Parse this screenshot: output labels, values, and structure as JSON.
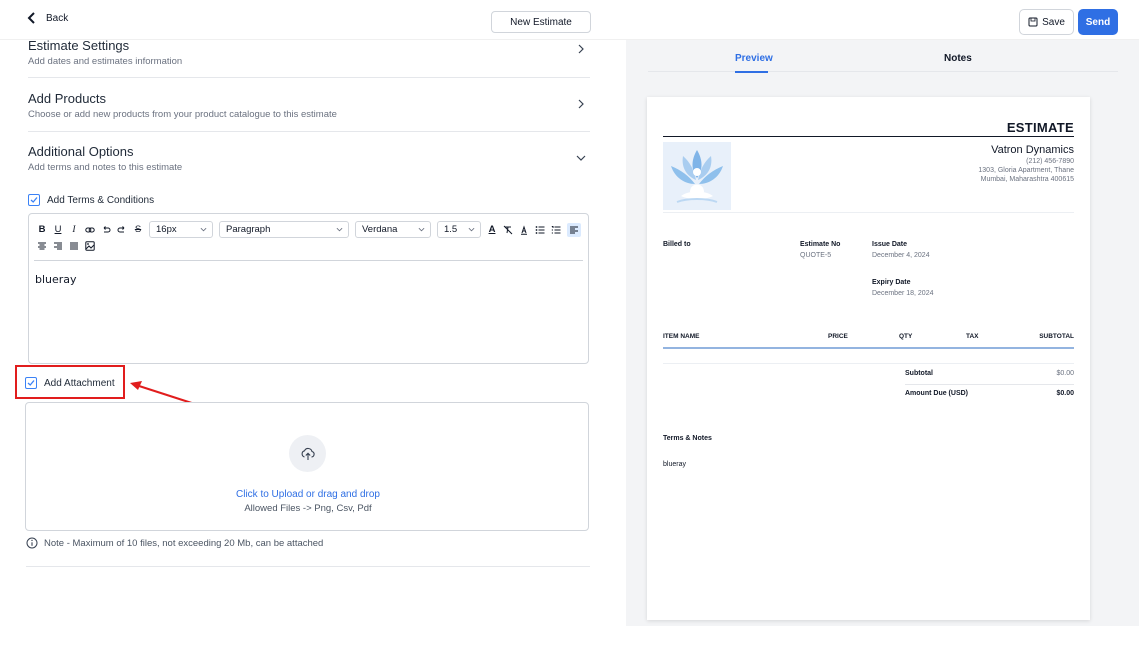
{
  "header": {
    "back_label": "Back",
    "document_title": "New Estimate",
    "save_label": "Save",
    "send_label": "Send"
  },
  "sections": [
    {
      "title": "Estimate Settings",
      "subtitle": "Add dates and estimates information",
      "expanded": false
    },
    {
      "title": "Add Products",
      "subtitle": "Choose or add new products from your product catalogue to this estimate",
      "expanded": false
    },
    {
      "title": "Additional Options",
      "subtitle": "Add terms and notes to this estimate",
      "expanded": true
    }
  ],
  "terms": {
    "checkbox_label": "Add Terms & Conditions",
    "checked": true,
    "font_size": "16px",
    "block_type": "Paragraph",
    "font_family": "Verdana",
    "line_height": "1.5",
    "content": "blueray"
  },
  "attachment": {
    "checkbox_label": "Add Attachment",
    "checked": true,
    "upload_prompt": "Click to Upload or drag and drop",
    "allowed_files": "Allowed Files -> Png, Csv, Pdf",
    "note": "Note - Maximum of 10 files, not exceeding 20 Mb, can be attached"
  },
  "preview": {
    "tabs": [
      "Preview",
      "Notes"
    ],
    "active_tab": "Preview",
    "doc_title": "ESTIMATE",
    "company_name": "Vatron Dynamics",
    "company_phone": "(212) 456-7890",
    "company_address1": "1303, Gloria Apartment, Thane",
    "company_address2": "Mumbai, Maharashtra 400615",
    "billed_to_label": "Billed to",
    "estimate_no_label": "Estimate No",
    "estimate_no": "QUOTE-5",
    "issue_date_label": "Issue Date",
    "issue_date": "December 4, 2024",
    "expiry_date_label": "Expiry Date",
    "expiry_date": "December 18, 2024",
    "columns": [
      "ITEM NAME",
      "PRICE",
      "QTY",
      "TAX",
      "SUBTOTAL"
    ],
    "subtotal_label": "Subtotal",
    "subtotal_value": "$0.00",
    "amount_due_label": "Amount Due (USD)",
    "amount_due_value": "$0.00",
    "terms_label": "Terms & Notes",
    "terms_text": "blueray"
  },
  "colors": {
    "accent": "#2f6fe4",
    "highlight": "#e11d1d"
  }
}
